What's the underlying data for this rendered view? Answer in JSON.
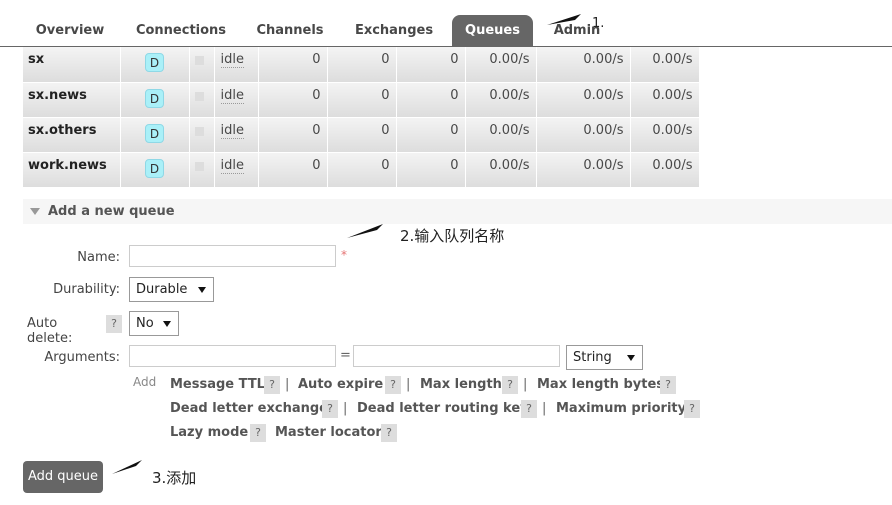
{
  "tabs": [
    {
      "label": "Overview",
      "active": false
    },
    {
      "label": "Connections",
      "active": false
    },
    {
      "label": "Channels",
      "active": false
    },
    {
      "label": "Exchanges",
      "active": false
    },
    {
      "label": "Queues",
      "active": true
    },
    {
      "label": "Admin",
      "active": false
    }
  ],
  "queues": [
    {
      "name": "sx",
      "feature": "D",
      "state": "idle",
      "ready": "0",
      "unacked": "0",
      "total": "0",
      "incoming": "0.00/s",
      "deliver": "0.00/s",
      "ack": "0.00/s"
    },
    {
      "name": "sx.news",
      "feature": "D",
      "state": "idle",
      "ready": "0",
      "unacked": "0",
      "total": "0",
      "incoming": "0.00/s",
      "deliver": "0.00/s",
      "ack": "0.00/s"
    },
    {
      "name": "sx.others",
      "feature": "D",
      "state": "idle",
      "ready": "0",
      "unacked": "0",
      "total": "0",
      "incoming": "0.00/s",
      "deliver": "0.00/s",
      "ack": "0.00/s"
    },
    {
      "name": "work.news",
      "feature": "D",
      "state": "idle",
      "ready": "0",
      "unacked": "0",
      "total": "0",
      "incoming": "0.00/s",
      "deliver": "0.00/s",
      "ack": "0.00/s"
    }
  ],
  "add_queue_section": {
    "label": "Add a new queue"
  },
  "form": {
    "name_label": "Name:",
    "name_value": "",
    "required_mark": "*",
    "durability_label": "Durability:",
    "durability_value": "Durable",
    "auto_delete_label": "Auto delete:",
    "auto_delete_value": "No",
    "arguments_label": "Arguments:",
    "arg_key_value": "",
    "equals": "=",
    "arg_value_value": "",
    "arg_type_value": "String",
    "add_label": "Add",
    "help_mark": "?",
    "separator": "|"
  },
  "argument_shortcuts": [
    "Message TTL",
    "Auto expire",
    "Max length",
    "Max length bytes",
    "Dead letter exchange",
    "Dead letter routing key",
    "Maximum priority",
    "Lazy mode",
    "Master locator"
  ],
  "add_queue_button": "Add queue",
  "annotations": {
    "step1": "1.",
    "step2": "2.输入队列名称",
    "step3": "3.添加"
  },
  "colors": {
    "tab_active_bg": "#666666",
    "badge_bg": "#aaf0f8",
    "button_bg": "#666666"
  },
  "icons": {
    "collapse": "triangle-down-icon",
    "select": "caret-down-icon",
    "annotation": "arrow-icon"
  }
}
